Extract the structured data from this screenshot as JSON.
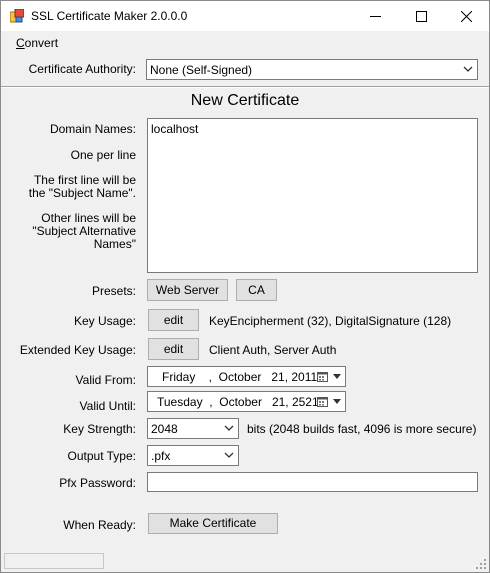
{
  "window": {
    "title": "SSL Certificate Maker 2.0.0.0",
    "controls": [
      "minimize-icon",
      "maximize-icon",
      "close-icon"
    ]
  },
  "menu": {
    "convert": "Convert"
  },
  "ca": {
    "label": "Certificate Authority:",
    "value": "None (Self-Signed)"
  },
  "form": {
    "title": "New Certificate",
    "domain_names_label": "Domain Names:",
    "domain_names_value": "localhost",
    "help_one_per_line": "One per line",
    "help_first_line": "The first line will be the \"Subject Name\".",
    "help_other_lines": "Other lines will be \"Subject Alternative Names\"",
    "presets_label": "Presets:",
    "preset_web_server": "Web Server",
    "preset_ca": "CA",
    "key_usage_label": "Key Usage:",
    "key_usage_edit": "edit",
    "key_usage_value": "KeyEncipherment (32), DigitalSignature (128)",
    "ext_key_usage_label": "Extended Key Usage:",
    "ext_key_usage_edit": "edit",
    "ext_key_usage_value": "Client Auth, Server Auth",
    "valid_from_label": "Valid From:",
    "valid_from_value": "Friday    ,  October   21, 2011",
    "valid_until_label": "Valid Until:",
    "valid_until_value": "Tuesday  ,  October   21, 2521",
    "key_strength_label": "Key Strength:",
    "key_strength_value": "2048",
    "key_strength_note": "bits (2048 builds fast, 4096 is more secure)",
    "output_type_label": "Output Type:",
    "output_type_value": ".pfx",
    "pfx_password_label": "Pfx Password:",
    "pfx_password_value": "",
    "when_ready_label": "When Ready:",
    "make_button": "Make Certificate"
  },
  "status": {
    "text": ""
  }
}
